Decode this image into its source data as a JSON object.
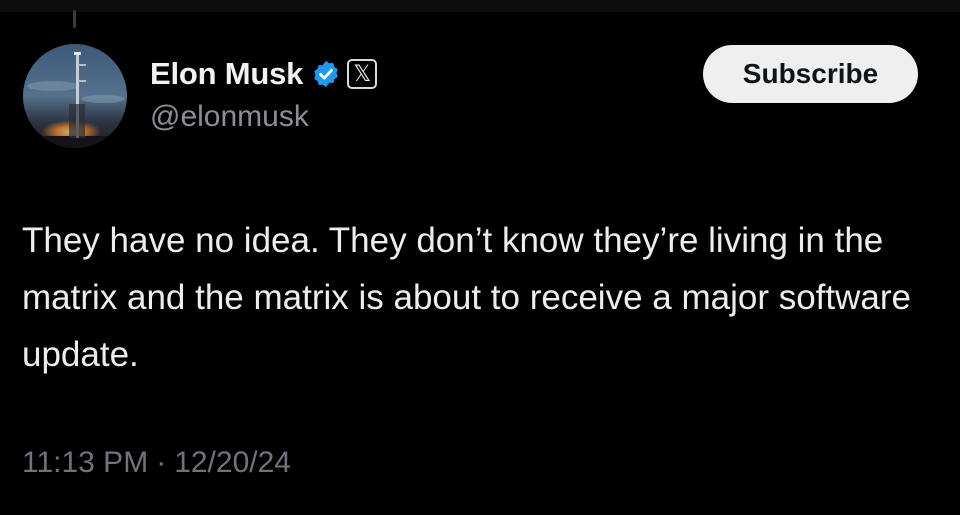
{
  "author": {
    "display_name": "Elon Musk",
    "handle": "@elonmusk",
    "verified_icon": "verified-badge-icon",
    "affiliate_icon": "x-logo-icon",
    "affiliate_glyph": "𝕏"
  },
  "actions": {
    "subscribe_label": "Subscribe"
  },
  "tweet": {
    "text": "They have no idea. They don’t know they’re living in the matrix and the matrix is about to receive a major software update.",
    "time": "11:13 PM",
    "separator": "·",
    "date": "12/20/24"
  },
  "colors": {
    "background": "#000000",
    "text": "#ededed",
    "secondary_text": "#8b8f94",
    "verified_blue": "#1d9bf0",
    "button_bg": "#efefef"
  }
}
